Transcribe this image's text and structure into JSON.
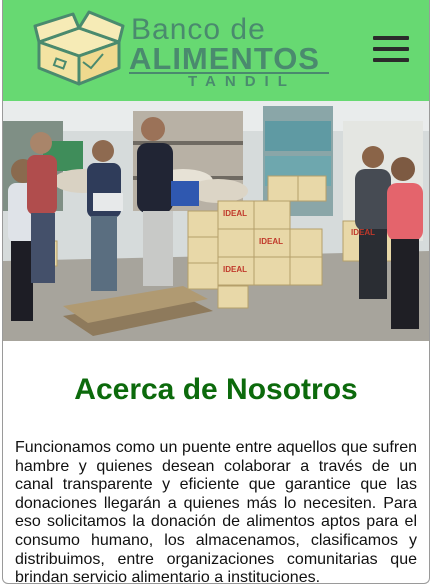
{
  "header": {
    "logo": {
      "line1": "Banco de",
      "line2": "ALIMENTOS",
      "line3": "TANDIL",
      "color": "#4a8a6e"
    },
    "background": "#67d972",
    "menu_icon": "hamburger-menu-icon"
  },
  "hero": {
    "description_icon": "photo"
  },
  "about": {
    "title": "Acerca de Nosotros",
    "title_color": "#0c6a0c",
    "text": "Funcionamos como un puente entre aquellos que sufren hambre y quienes desean colaborar a través de un canal transparente y eficiente que garantice que las donaciones llegarán a quienes más lo necesiten. Para eso solicitamos la donación de alimentos aptos para el consumo humano, los almacenamos, clasificamos y distribuimos, entre organizaciones comunitarias que brindan servicio alimentario a instituciones."
  },
  "box_label": "IDEAL"
}
